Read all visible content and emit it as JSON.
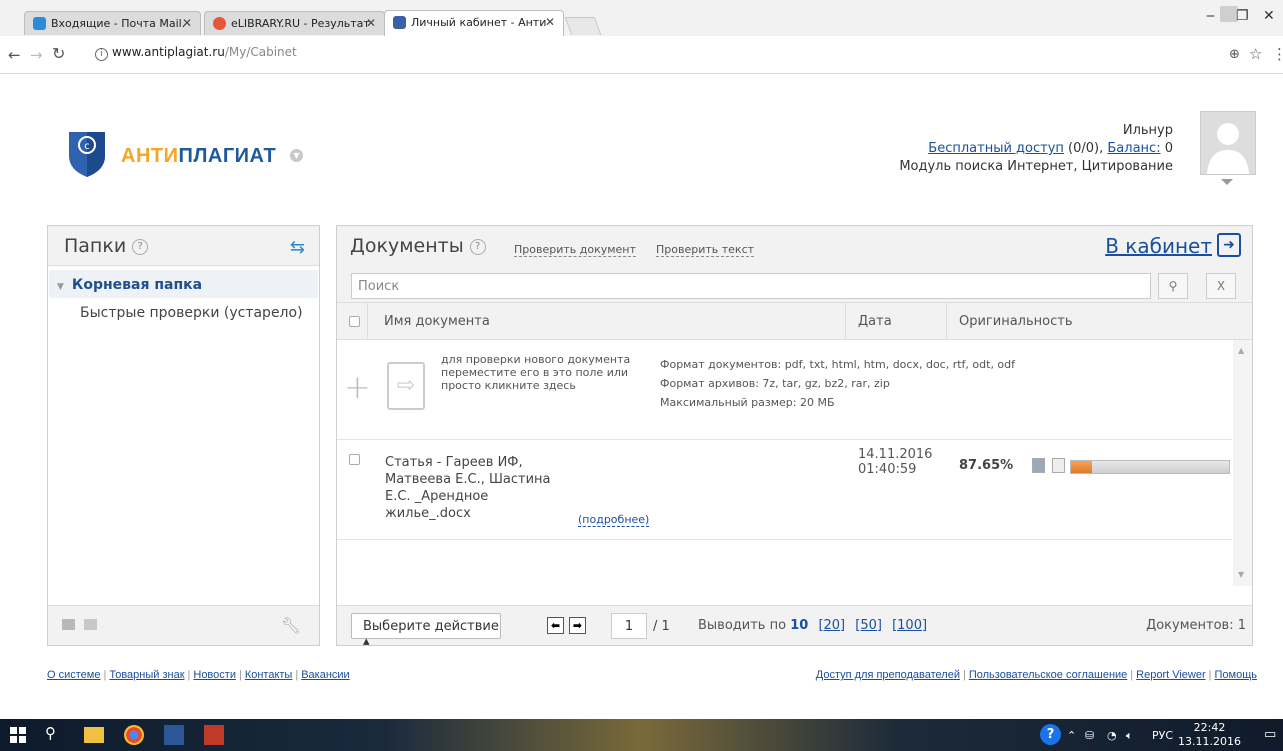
{
  "browser": {
    "tabs": [
      {
        "label": "Входящие - Почта Mail.",
        "color": "#2a8bd8"
      },
      {
        "label": "eLIBRARY.RU - Результат",
        "color": "#e8553a"
      },
      {
        "label": "Личный кабинет - Анти",
        "color": "#3b5fa8"
      }
    ],
    "url_host": "www.antiplagiat.ru",
    "url_path": "/My/Cabinet"
  },
  "logo": {
    "part1": "АНТИ",
    "part2": "ПЛАГИАТ"
  },
  "user": {
    "name": "Ильнур",
    "free_access_label": "Бесплатный доступ",
    "free_access_count": "(0/0),",
    "balance_label": "Баланс:",
    "balance_value": "0",
    "modules": "Модуль поиска Интернет, Цитирование"
  },
  "folders": {
    "title": "Папки",
    "root": "Корневая папка",
    "quick": "Быстрые проверки (устарело)"
  },
  "documents": {
    "title": "Документы",
    "check_document": "Проверить документ",
    "check_text": "Проверить текст",
    "cabinet_link": "В кабинет",
    "search_placeholder": "Поиск",
    "search_button": "⚲",
    "clear_button": "X",
    "columns": {
      "name": "Имя документа",
      "date": "Дата",
      "originality": "Оригинальность"
    },
    "upload_hint": "для проверки нового документа переместите его в это поле или просто кликните здесь",
    "formats": [
      "Формат документов: pdf, txt, html, htm, docx, doc, rtf, odt, odf",
      "Формат архивов: 7z, tar, gz, bz2, rar, zip",
      "Максимальный размер: 20 МБ"
    ],
    "rows": [
      {
        "name": "Статья - Гареев ИФ, Матвеева Е.С., Шастина Е.С. _Арендное жилье_.docx",
        "more": "(подробнее)",
        "date": "14.11.2016",
        "time": "01:40:59",
        "originality": "87.65%",
        "bar_fill": 0.13
      }
    ],
    "footer": {
      "action": "Выберите действие ▴",
      "prev": "⬅",
      "next": "➡",
      "page": "1",
      "total": "/ 1",
      "per_page_label": "Выводить по",
      "per_page_current": "10",
      "per_page_opts": [
        "[20]",
        "[50]",
        "[100]"
      ],
      "doc_count": "Документов: 1"
    }
  },
  "footer_left": [
    "О системе",
    "Товарный знак",
    "Новости",
    "Контакты",
    "Вакансии"
  ],
  "footer_right": [
    "Доступ для преподавателей",
    "Пользовательское соглашение",
    "Report Viewer",
    "Помощь"
  ],
  "taskbar": {
    "lang": "РУС",
    "time": "22:42",
    "date": "13.11.2016"
  }
}
